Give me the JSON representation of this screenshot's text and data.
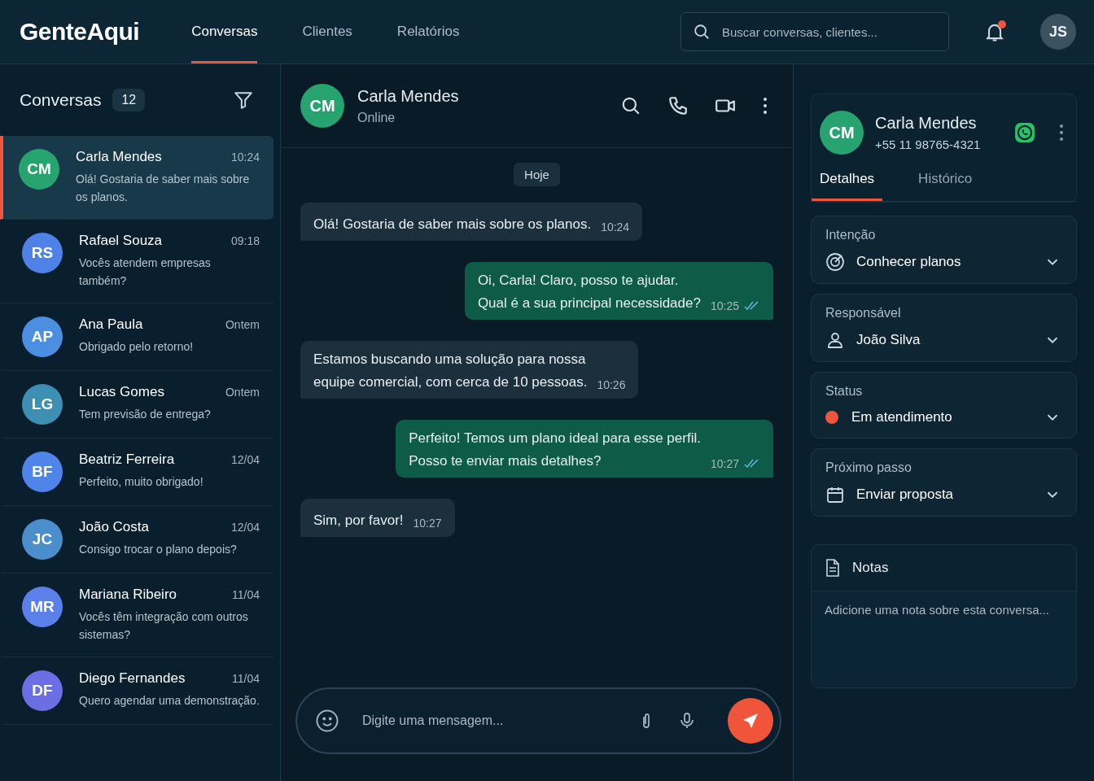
{
  "app": {
    "logo": "GenteAqui",
    "nav": [
      {
        "label": "Conversas",
        "selected": true
      },
      {
        "label": "Clientes",
        "selected": false
      },
      {
        "label": "Relatórios",
        "selected": false
      }
    ],
    "search": {
      "placeholder": "Buscar conversas, clientes..."
    },
    "notification": {
      "unread": true
    },
    "user_initials": "JS"
  },
  "sidebar": {
    "title": "Conversas",
    "count": "12",
    "conversations": [
      {
        "initials": "CM",
        "color": "#27a36f",
        "name": "Carla Mendes",
        "time": "10:24",
        "preview": "Olá! Gostaria de saber mais sobre os planos.",
        "selected": true
      },
      {
        "initials": "RS",
        "color": "#4f82e6",
        "name": "Rafael Souza",
        "time": "09:18",
        "preview": "Vocês atendem empresas também?",
        "selected": false
      },
      {
        "initials": "AP",
        "color": "#4b8fe2",
        "name": "Ana Paula",
        "time": "Ontem",
        "preview": "Obrigado pelo retorno!",
        "selected": false
      },
      {
        "initials": "LG",
        "color": "#3d8fb3",
        "name": "Lucas Gomes",
        "time": "Ontem",
        "preview": "Tem previsão de entrega?",
        "selected": false
      },
      {
        "initials": "BF",
        "color": "#4f84e8",
        "name": "Beatriz Ferreira",
        "time": "12/04",
        "preview": "Perfeito, muito obrigado!",
        "selected": false
      },
      {
        "initials": "JC",
        "color": "#4a8fcc",
        "name": "João Costa",
        "time": "12/04",
        "preview": "Consigo trocar o plano depois?",
        "selected": false
      },
      {
        "initials": "MR",
        "color": "#5c80ea",
        "name": "Mariana Ribeiro",
        "time": "11/04",
        "preview": "Vocês têm integração com outros sistemas?",
        "selected": false
      },
      {
        "initials": "DF",
        "color": "#6b6fe3",
        "name": "Diego Fernandes",
        "time": "11/04",
        "preview": "Quero agendar uma demonstração.",
        "selected": false
      }
    ]
  },
  "chat": {
    "initials": "CM",
    "name": "Carla Mendes",
    "status": "Online",
    "day": "Hoje",
    "messages": [
      {
        "kind": "in",
        "lines": [
          "Olá! Gostaria de saber mais sobre os planos."
        ],
        "time": "10:24",
        "read": false
      },
      {
        "kind": "out",
        "lines": [
          "Oi, Carla! Claro, posso te ajudar.",
          "Qual é a sua principal necessidade?"
        ],
        "time": "10:25",
        "read": true
      },
      {
        "kind": "in",
        "lines": [
          "Estamos buscando uma solução para nossa",
          "equipe comercial, com cerca de 10 pessoas."
        ],
        "time": "10:26",
        "read": false
      },
      {
        "kind": "out",
        "lines": [
          "Perfeito! Temos um plano ideal para esse perfil.",
          "Posso te enviar mais detalhes?"
        ],
        "time": "10:27",
        "read": true
      },
      {
        "kind": "in",
        "lines": [
          "Sim, por favor!"
        ],
        "time": "10:27",
        "read": false
      }
    ],
    "composer": {
      "placeholder": "Digite uma mensagem..."
    }
  },
  "details": {
    "initials": "CM",
    "name": "Carla Mendes",
    "phone": "+55 11 98765-4321",
    "tabs": [
      {
        "label": "Detalhes",
        "selected": true
      },
      {
        "label": "Histórico",
        "selected": false
      }
    ],
    "fields": [
      {
        "kind": "target",
        "label": "Intenção",
        "value": "Conhecer planos"
      },
      {
        "kind": "person",
        "label": "Responsável",
        "value": "João Silva"
      },
      {
        "kind": "status",
        "label": "Status",
        "value": "Em atendimento",
        "color": "#f0553b"
      },
      {
        "kind": "calendar",
        "label": "Próximo passo",
        "value": "Enviar proposta"
      }
    ],
    "notes": {
      "title": "Notas",
      "placeholder": "Adicione uma nota sobre esta conversa..."
    }
  }
}
